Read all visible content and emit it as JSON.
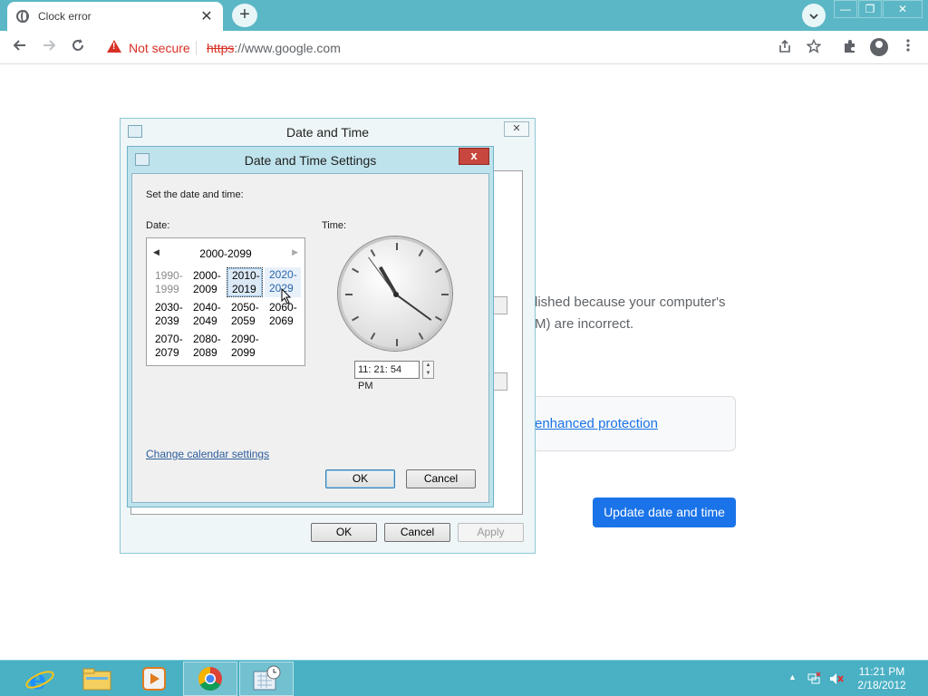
{
  "browser": {
    "tab_title": "Clock error",
    "tab_close": "✕",
    "new_tab": "+",
    "security_label": "Not secure",
    "url_scheme": "https",
    "url_rest": "://www.google.com",
    "window_controls": [
      "—",
      "❐",
      "✕"
    ]
  },
  "page": {
    "error_line1": "lished because your computer's",
    "error_line2": "M) are incorrect.",
    "enhanced_link": "enhanced protection",
    "update_button": "Update date and time"
  },
  "date_time_dialog": {
    "title": "Date and Time",
    "ok": "OK",
    "cancel": "Cancel",
    "apply": "Apply"
  },
  "settings_dialog": {
    "title": "Date and Time Settings",
    "close": "x",
    "instruction": "Set the date and time:",
    "date_label": "Date:",
    "time_label": "Time:",
    "decade_header": "2000-2099",
    "decades": [
      [
        "1990-",
        "1999"
      ],
      [
        "2000-",
        "2009"
      ],
      [
        "2010-",
        "2019"
      ],
      [
        "2020-",
        "2029"
      ],
      [
        "2030-",
        "2039"
      ],
      [
        "2040-",
        "2049"
      ],
      [
        "2050-",
        "2059"
      ],
      [
        "2060-",
        "2069"
      ],
      [
        "2070-",
        "2079"
      ],
      [
        "2080-",
        "2089"
      ],
      [
        "2090-",
        "2099"
      ]
    ],
    "time_value": "11: 21: 54 PM",
    "calendar_link": "Change calendar settings",
    "ok": "OK",
    "cancel": "Cancel"
  },
  "taskbar": {
    "time": "11:21 PM",
    "date": "2/18/2012",
    "colors": {
      "background": "#4ab0c4"
    }
  }
}
